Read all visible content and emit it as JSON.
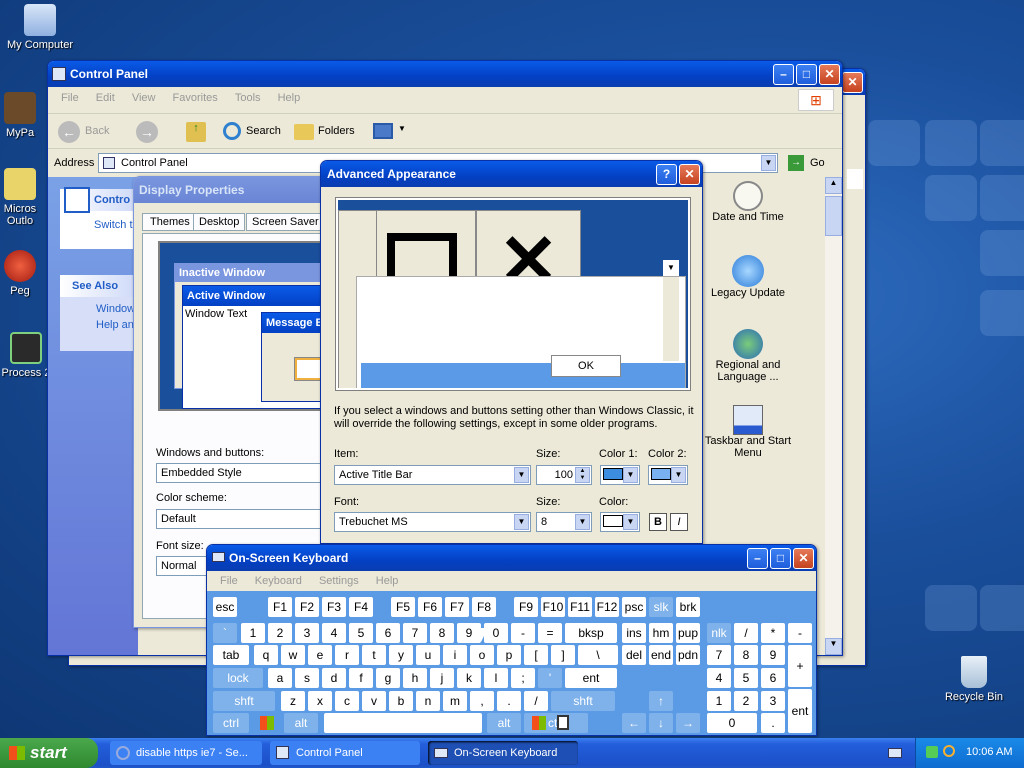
{
  "desktop": {
    "icons": [
      {
        "label": "My Computer",
        "icon": "computer-icon"
      },
      {
        "label": "MyPa",
        "icon": "mypa-icon"
      },
      {
        "label": "Micros Outlo",
        "icon": "outlook-icon"
      },
      {
        "label": "Peg",
        "icon": "peg-icon"
      },
      {
        "label": "Process 2",
        "icon": "process-icon"
      },
      {
        "label": "Recycle Bin",
        "icon": "recycle-bin-icon"
      }
    ]
  },
  "control_panel": {
    "title": "Control Panel",
    "menu": [
      "File",
      "Edit",
      "View",
      "Favorites",
      "Tools",
      "Help"
    ],
    "toolbar": {
      "back": "Back",
      "search": "Search",
      "folders": "Folders"
    },
    "address_label": "Address",
    "address_value": "Control Panel",
    "go": "Go",
    "side": {
      "header": "Contro",
      "switch": "Switch t",
      "see_also": "See Also",
      "link1": "Window",
      "link2": "Help an"
    },
    "items": [
      {
        "label": "Date and Time",
        "icon": "clock-icon"
      },
      {
        "label": "Legacy Update",
        "icon": "update-icon"
      },
      {
        "label": "Regional and Language ...",
        "icon": "globe-icon"
      },
      {
        "label": "Taskbar and Start Menu",
        "icon": "taskbar-icon"
      }
    ]
  },
  "display_properties": {
    "title": "Display Properties",
    "tabs": [
      "Themes",
      "Desktop",
      "Screen Saver"
    ],
    "preview": {
      "inactive": "Inactive Window",
      "active": "Active Window",
      "window_text": "Window Text",
      "message": "Message B"
    },
    "windows_buttons_label": "Windows and buttons:",
    "windows_buttons_value": "Embedded Style",
    "color_scheme_label": "Color scheme:",
    "color_scheme_value": "Default",
    "font_size_label": "Font size:",
    "font_size_value": "Normal"
  },
  "advanced_appearance": {
    "title": "Advanced Appearance",
    "ok": "OK",
    "note": "If you select a windows and buttons setting other than Windows Classic, it will override the following settings, except in some older programs.",
    "item_label": "Item:",
    "item_value": "Active Title Bar",
    "size_label": "Size:",
    "size_value": "100",
    "color1_label": "Color 1:",
    "color2_label": "Color 2:",
    "font_label": "Font:",
    "font_value": "Trebuchet MS",
    "font_size_label": "Size:",
    "font_size_value": "8",
    "color_label": "Color:",
    "bold": "B",
    "italic": "I",
    "colors": {
      "color1": "#3c8de0",
      "color2": "#78b0f0",
      "font_color": "#ffffff"
    }
  },
  "osk": {
    "title": "On-Screen Keyboard",
    "menu": [
      "File",
      "Keyboard",
      "Settings",
      "Help"
    ],
    "row0": [
      "esc",
      "F1",
      "F2",
      "F3",
      "F4",
      "F5",
      "F6",
      "F7",
      "F8",
      "F9",
      "F10",
      "F11",
      "F12",
      "psc",
      "slk",
      "brk"
    ],
    "row1": [
      "`",
      "1",
      "2",
      "3",
      "4",
      "5",
      "6",
      "7",
      "8",
      "9",
      "0",
      "-",
      "=",
      "bksp",
      "ins",
      "hm",
      "pup",
      "nlk",
      "/",
      "*",
      "-"
    ],
    "row2": [
      "tab",
      "q",
      "w",
      "e",
      "r",
      "t",
      "y",
      "u",
      "i",
      "o",
      "p",
      "[",
      "]",
      "\\",
      "del",
      "end",
      "pdn",
      "7",
      "8",
      "9",
      "+"
    ],
    "row3": [
      "lock",
      "a",
      "s",
      "d",
      "f",
      "g",
      "h",
      "j",
      "k",
      "l",
      ";",
      "'",
      "ent",
      "4",
      "5",
      "6"
    ],
    "row4": [
      "shft",
      "z",
      "x",
      "c",
      "v",
      "b",
      "n",
      "m",
      ",",
      ".",
      "/",
      "shft",
      "↑",
      "1",
      "2",
      "3",
      "ent"
    ],
    "row5": [
      "ctrl",
      "alt",
      "",
      "alt",
      "ctrl",
      "←",
      "↓",
      "→",
      "0",
      "."
    ]
  },
  "taskbar": {
    "start": "start",
    "tasks": [
      {
        "label": "disable https ie7 - Se...",
        "icon": "ie-icon"
      },
      {
        "label": "Control Panel",
        "icon": "control-panel-icon"
      },
      {
        "label": "On-Screen Keyboard",
        "icon": "keyboard-icon"
      }
    ],
    "clock": "10:06 AM"
  }
}
